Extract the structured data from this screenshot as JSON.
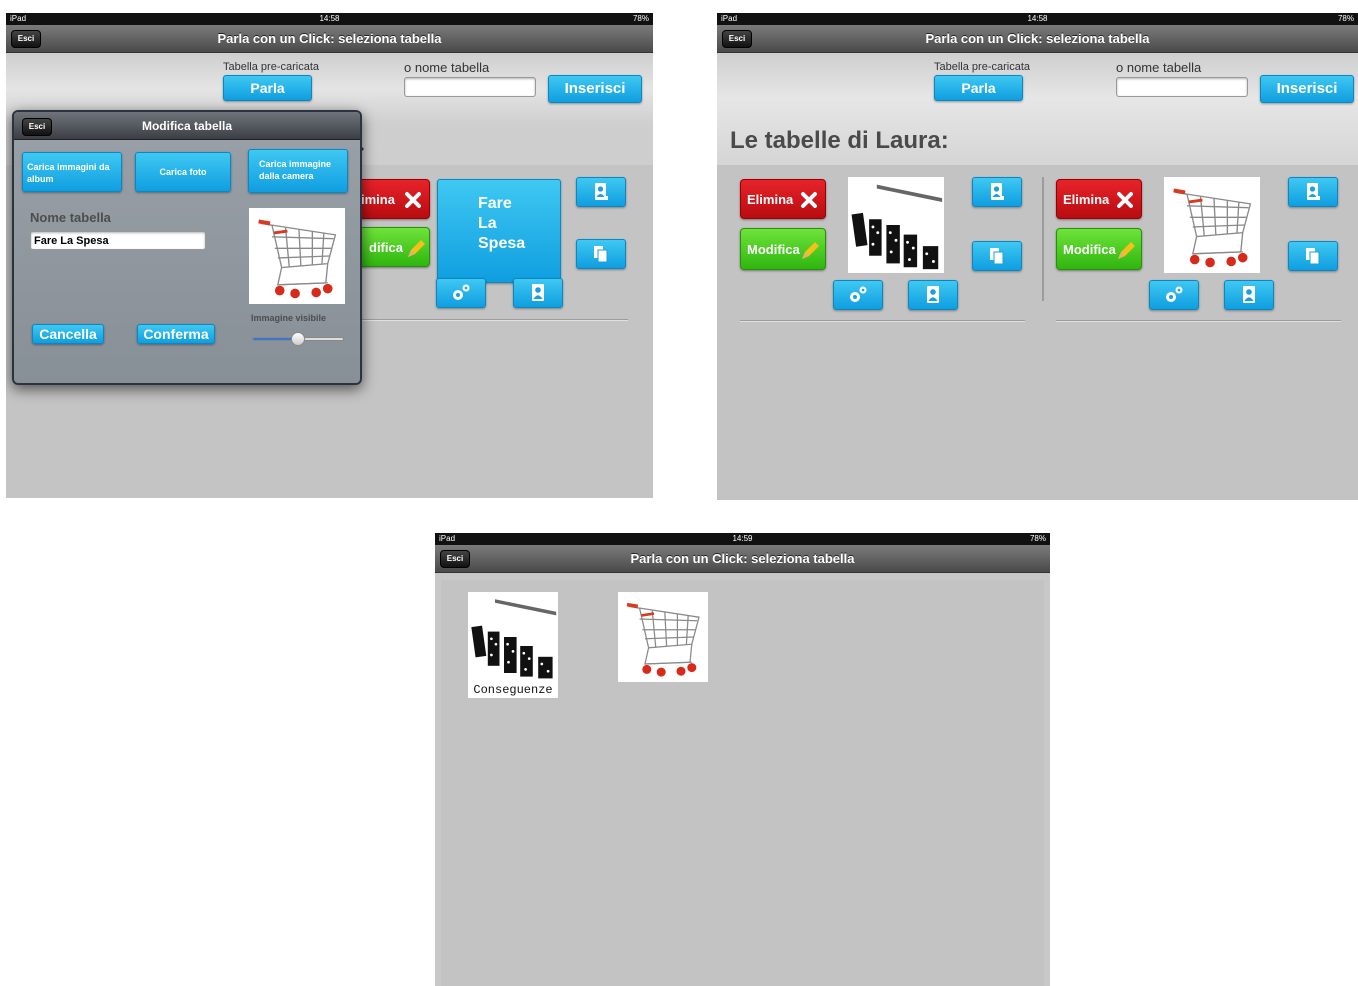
{
  "status": {
    "device": "iPad",
    "time_a": "14:58",
    "time_b": "14:58",
    "time_c": "14:59",
    "battery": "78%"
  },
  "nav": {
    "back_label": "Esci",
    "title": "Parla con un Click: seleziona tabella"
  },
  "topbar": {
    "preloaded_label": "Tabella pre-caricata",
    "speak_button": "Parla",
    "name_label": "o nome tabella",
    "name_value": "",
    "insert_button": "Inserisci"
  },
  "tables_heading": "Le tabelle di Laura:",
  "table_card": {
    "delete_label": "Elimina",
    "edit_label": "Modifica"
  },
  "table_cards": [
    {
      "image": "dominoes"
    },
    {
      "image": "shopping-cart"
    }
  ],
  "left_card": {
    "delete_label": "imina",
    "edit_label": "difica",
    "big_button": [
      "Fare",
      "La",
      "Spesa"
    ]
  },
  "popover": {
    "back_label": "Esci",
    "title": "Modifica tabella",
    "btn_album": "Carica immagini da album",
    "btn_photo": "Carica foto",
    "btn_camera": "Carica immagine dalla camera",
    "name_label": "Nome tabella",
    "name_value": "Fare La Spesa",
    "cancel_button": "Cancella",
    "confirm_button": "Conferma",
    "visibility_label": "Immagine visibile",
    "visibility_value": 0.5
  },
  "grid_items": [
    {
      "label": "Conseguenze",
      "image": "dominoes"
    },
    {
      "label": "",
      "image": "shopping-cart"
    }
  ],
  "colors": {
    "red": "#d01418",
    "green": "#44c81f",
    "blue": "#1fb0ea"
  },
  "icons": [
    "x-icon",
    "pencil-icon",
    "person-card-icon",
    "copy-icon",
    "gears-icon",
    "person-icon",
    "shopping-cart-image",
    "dominoes-image"
  ]
}
